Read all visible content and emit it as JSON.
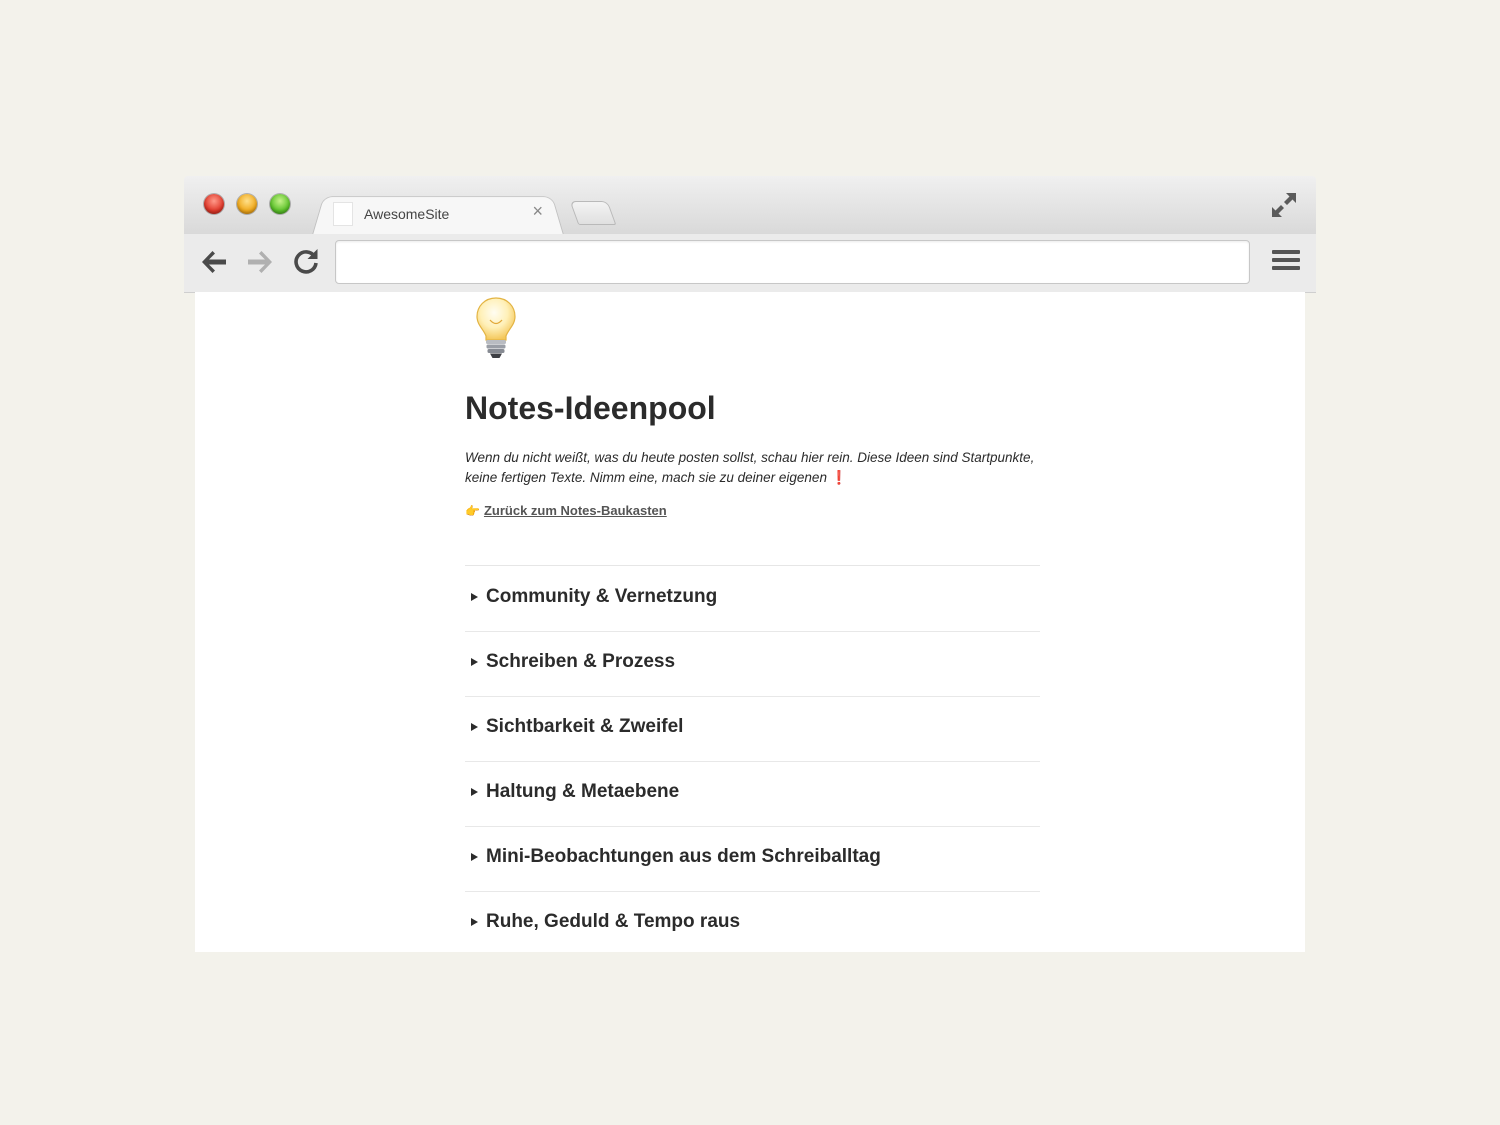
{
  "browser": {
    "tab_title": "AwesomeSite",
    "tab_close": "×",
    "address": ""
  },
  "page": {
    "icon": "light-bulb",
    "title": "Notes-Ideenpool",
    "intro": "Wenn du nicht weißt, was du heute posten sollst, schau hier rein. Diese Ideen sind Startpunkte, keine fertigen Texte. Nimm eine, mach sie zu deiner eigenen",
    "intro_emphasis": "❗",
    "back_pointer": "👉",
    "back_link": "Zurück zum Notes-Baukasten",
    "toggles": [
      {
        "label": "Community & Vernetzung"
      },
      {
        "label": "Schreiben & Prozess"
      },
      {
        "label": "Sichtbarkeit & Zweifel"
      },
      {
        "label": "Haltung & Metaebene"
      },
      {
        "label": "Mini-Beobachtungen aus dem Schreiballtag"
      },
      {
        "label": "Ruhe, Geduld & Tempo raus"
      }
    ]
  }
}
